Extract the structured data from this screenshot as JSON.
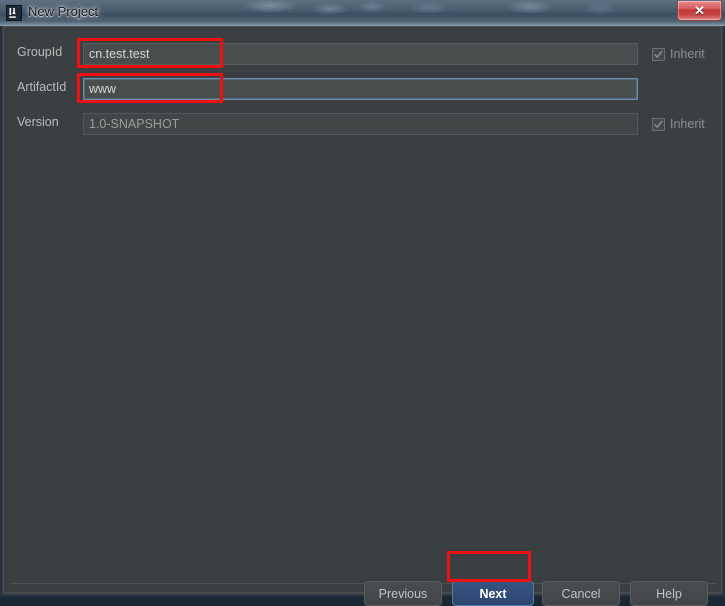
{
  "window": {
    "title": "New Project",
    "app_icon": "intellij-idea-icon",
    "close_label": "✕"
  },
  "form": {
    "rows": [
      {
        "label": "GroupId",
        "value": "cn.test.test",
        "state": "editable",
        "inherit": {
          "label": "Inherit",
          "checked": true,
          "disabled": true,
          "visible": true
        }
      },
      {
        "label": "ArtifactId",
        "value": "www",
        "state": "focused",
        "inherit": {
          "label": "",
          "checked": false,
          "disabled": false,
          "visible": false
        }
      },
      {
        "label": "Version",
        "value": "1.0-SNAPSHOT",
        "state": "disabled",
        "inherit": {
          "label": "Inherit",
          "checked": true,
          "disabled": true,
          "visible": true
        }
      }
    ]
  },
  "footer": {
    "previous_label": "Previous",
    "next_label": "Next",
    "cancel_label": "Cancel",
    "help_label": "Help",
    "default_button": "Next"
  },
  "annotations": {
    "color": "#ee1111",
    "targets": [
      "groupid-input",
      "artifactid-input",
      "next-button"
    ]
  },
  "colors": {
    "panel_bg": "#3c3f41",
    "input_bg": "#4a4d4e",
    "accent_blue": "#365481",
    "focus_border": "#6a8bb0",
    "close_red": "#bf3636"
  }
}
